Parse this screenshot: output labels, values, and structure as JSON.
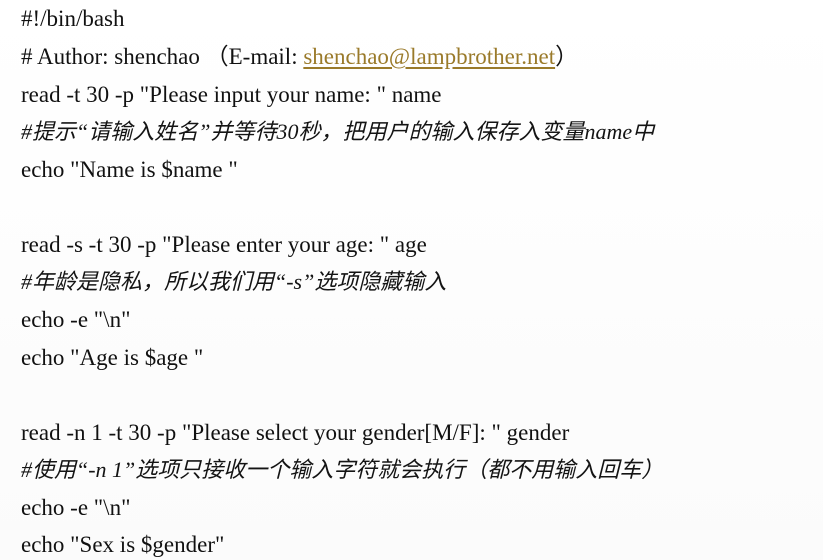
{
  "lines": [
    {
      "text": "#!/bin/bash"
    },
    {
      "prefix": "# Author: shenchao （E-mail: ",
      "email": "shenchao@lampbrother.net",
      "suffix": "）"
    },
    {
      "text": "read -t 30 -p \"Please input your name: \" name"
    },
    {
      "text": "#提示“请输入姓名”并等待30秒，把用户的输入保存入变量name中"
    },
    {
      "text": "echo \"Name is $name \""
    },
    {
      "text": "read -s -t 30 -p \"Please enter your age: \" age"
    },
    {
      "text": "#年龄是隐私，所以我们用“-s”选项隐藏输入"
    },
    {
      "text": "echo -e \"\\n\""
    },
    {
      "text": "echo \"Age is $age \""
    },
    {
      "text": "read -n 1 -t 30 -p \"Please select your gender[M/F]: \" gender"
    },
    {
      "text": "#使用“-n 1”选项只接收一个输入字符就会执行（都不用输入回车）"
    },
    {
      "text": "echo -e \"\\n\""
    },
    {
      "text": "echo \"Sex is $gender\""
    }
  ]
}
